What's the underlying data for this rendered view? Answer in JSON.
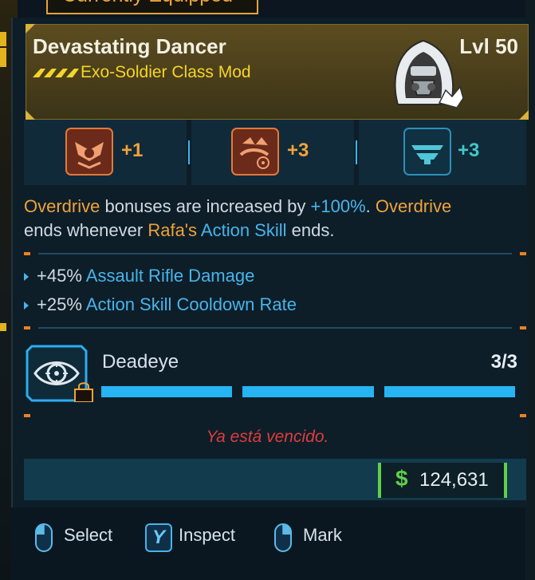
{
  "header_tab": {
    "label": "Currently Equipped"
  },
  "item": {
    "name": "Devastating Dancer",
    "type": "Exo-Soldier Class Mod",
    "level": "Lvl 50",
    "rarity_icon": "legendary-chevrons-icon",
    "portrait_icon": "hooded-exo-soldier-icon"
  },
  "skills": [
    {
      "icon": "tactical-mask-icon",
      "value": "+1",
      "color": "#f0a23a"
    },
    {
      "icon": "dancer-reticle-icon",
      "value": "+3",
      "color": "#f0a23a"
    },
    {
      "icon": "chevron-stack-icon",
      "value": "+3",
      "color": "#42c8c8"
    }
  ],
  "description": {
    "p1": "Overdrive",
    "p2": " bonuses are increased by ",
    "p3": "+100%",
    "p4": ". ",
    "p5": "Overdrive",
    "p6": " ends whenever ",
    "p7": "Rafa's",
    "p8": " ",
    "p9": "Action Skill",
    "p10": " ends."
  },
  "stats": [
    {
      "value": "+45%",
      "label": "Assault Rifle Damage"
    },
    {
      "value": "+25%",
      "label": "Action Skill Cooldown Rate"
    }
  ],
  "augment": {
    "name": "Deadeye",
    "count": "3/3",
    "filled": 3,
    "total": 3,
    "icon": "eye-target-icon",
    "lock_icon": "lock-icon"
  },
  "warning": "Ya está vencido.",
  "price": {
    "symbol": "$",
    "value": "124,631"
  },
  "hints": [
    {
      "icon": "mouse-left-icon",
      "label": "Select"
    },
    {
      "icon": "y-button-icon",
      "key": "Y",
      "label": "Inspect"
    },
    {
      "icon": "mouse-right-icon",
      "label": "Mark"
    }
  ],
  "colors": {
    "accent_orange": "#f0a23a",
    "accent_blue": "#48b4ea",
    "legendary_gold": "#f4d62a",
    "price_green": "#5ed04a",
    "warning_red": "#e03c3c"
  }
}
